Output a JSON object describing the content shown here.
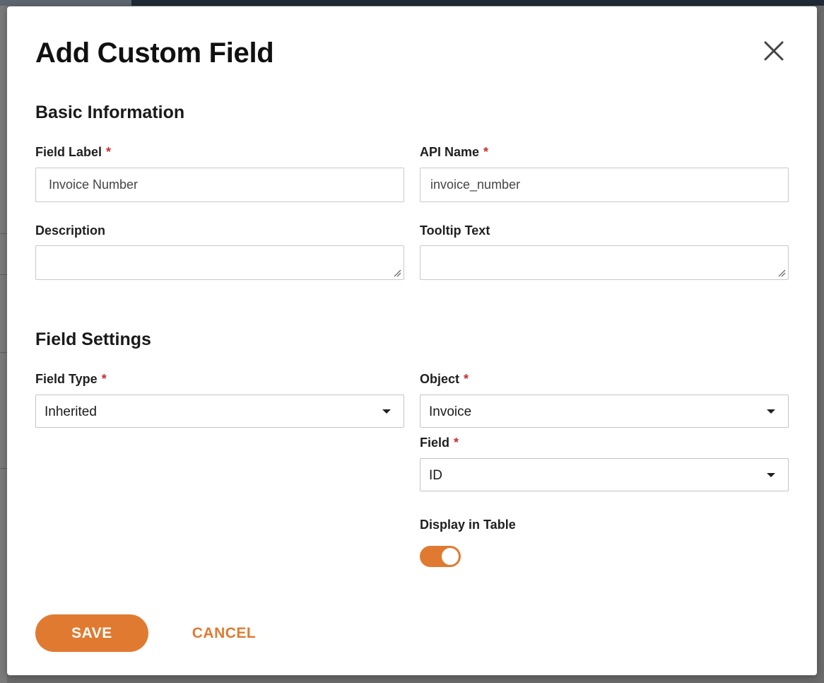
{
  "modal": {
    "title": "Add Custom Field",
    "close_icon": "close-icon"
  },
  "sections": {
    "basic": "Basic Information",
    "settings": "Field Settings"
  },
  "fields": {
    "field_label": {
      "label": "Field Label",
      "required": "*",
      "value": "Invoice Number"
    },
    "api_name": {
      "label": "API Name",
      "required": "*",
      "value": "invoice_number"
    },
    "description": {
      "label": "Description",
      "value": ""
    },
    "tooltip": {
      "label": "Tooltip Text",
      "value": ""
    },
    "field_type": {
      "label": "Field Type",
      "required": "*",
      "selected": "Inherited"
    },
    "object": {
      "label": "Object",
      "required": "*",
      "selected": "Invoice"
    },
    "field": {
      "label": "Field",
      "required": "*",
      "selected": "ID"
    },
    "display_in_table": {
      "label": "Display in Table",
      "on": true
    }
  },
  "buttons": {
    "save": "SAVE",
    "cancel": "CANCEL"
  },
  "colors": {
    "accent": "#e07a31",
    "required": "#c9302c"
  }
}
